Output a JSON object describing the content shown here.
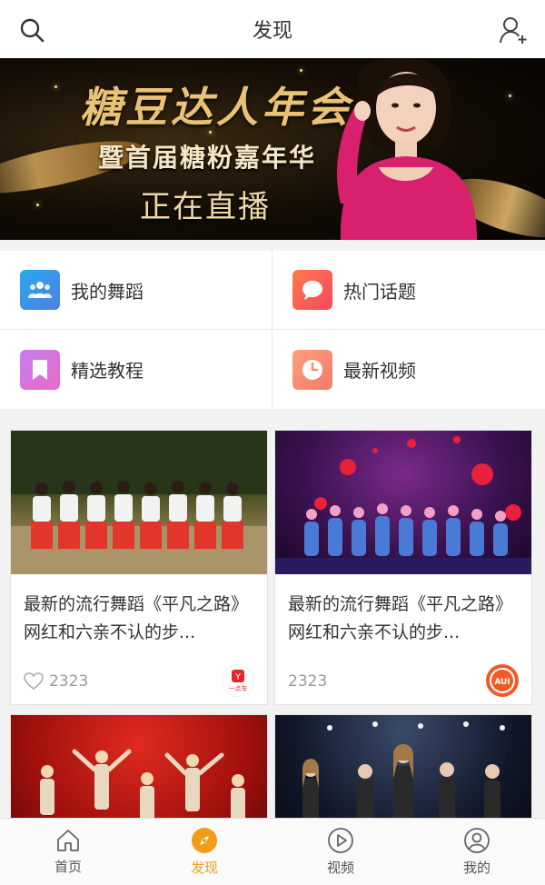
{
  "header": {
    "title": "发现",
    "left_icon": "search-icon",
    "right_icon": "add-user-icon"
  },
  "banner": {
    "line1": "糖豆达人年会",
    "line2": "暨首届糖粉嘉年华",
    "line3": "正在直播",
    "dots_total": 4,
    "dots_active_index": 2
  },
  "quick_links": [
    {
      "label": "我的舞蹈",
      "icon": "users-icon",
      "color": "#3a8fe8"
    },
    {
      "label": "热门话题",
      "icon": "chat-bubble-icon",
      "color": "#f25a4f"
    },
    {
      "label": "精选教程",
      "icon": "bookmark-icon",
      "color": "#b86fe0"
    },
    {
      "label": "最新视频",
      "icon": "clock-icon",
      "color": "#f7836a"
    }
  ],
  "feed": [
    {
      "title": "最新的流行舞蹈《平凡之路》网红和六亲不认的步...",
      "likes": "2323",
      "has_heart": true,
      "badge": "一点车",
      "thumb_theme": "park-dance"
    },
    {
      "title": "最新的流行舞蹈《平凡之路》网红和六亲不认的步...",
      "likes": "2323",
      "has_heart": false,
      "badge": "AUI",
      "thumb_theme": "stage-flowers"
    },
    {
      "title": "",
      "likes": "",
      "has_heart": false,
      "badge": "",
      "thumb_theme": "red-stage"
    },
    {
      "title": "",
      "likes": "",
      "has_heart": false,
      "badge": "",
      "thumb_theme": "dark-stage"
    }
  ],
  "tabs": [
    {
      "label": "首页",
      "icon": "home-icon",
      "active": false
    },
    {
      "label": "发现",
      "icon": "compass-icon",
      "active": true
    },
    {
      "label": "视频",
      "icon": "play-icon",
      "active": false
    },
    {
      "label": "我的",
      "icon": "profile-icon",
      "active": false
    }
  ],
  "colors": {
    "accent": "#f39c1b",
    "banner_gold": "#e9c275"
  }
}
